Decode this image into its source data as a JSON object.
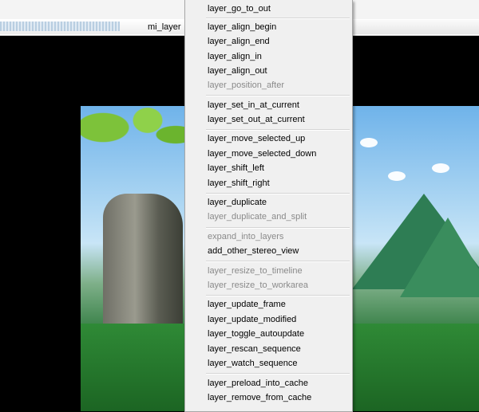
{
  "header": {
    "panel_label": "mi_layer"
  },
  "menu": {
    "items": [
      {
        "label": "layer_go_to_out",
        "enabled": true
      },
      {
        "label": "layer_align_begin",
        "enabled": true
      },
      {
        "label": "layer_align_end",
        "enabled": true
      },
      {
        "label": "layer_align_in",
        "enabled": true
      },
      {
        "label": "layer_align_out",
        "enabled": true
      },
      {
        "label": "layer_position_after",
        "enabled": false
      },
      {
        "label": "layer_set_in_at_current",
        "enabled": true
      },
      {
        "label": "layer_set_out_at_current",
        "enabled": true
      },
      {
        "label": "layer_move_selected_up",
        "enabled": true
      },
      {
        "label": "layer_move_selected_down",
        "enabled": true
      },
      {
        "label": "layer_shift_left",
        "enabled": true
      },
      {
        "label": "layer_shift_right",
        "enabled": true
      },
      {
        "label": "layer_duplicate",
        "enabled": true
      },
      {
        "label": "layer_duplicate_and_split",
        "enabled": false
      },
      {
        "label": "expand_into_layers",
        "enabled": false
      },
      {
        "label": "add_other_stereo_view",
        "enabled": true
      },
      {
        "label": "layer_resize_to_timeline",
        "enabled": false
      },
      {
        "label": "layer_resize_to_workarea",
        "enabled": false
      },
      {
        "label": "layer_update_frame",
        "enabled": true
      },
      {
        "label": "layer_update_modified",
        "enabled": true
      },
      {
        "label": "layer_toggle_autoupdate",
        "enabled": true
      },
      {
        "label": "layer_rescan_sequence",
        "enabled": true
      },
      {
        "label": "layer_watch_sequence",
        "enabled": true
      },
      {
        "label": "layer_preload_into_cache",
        "enabled": true
      },
      {
        "label": "layer_remove_from_cache",
        "enabled": true
      }
    ]
  }
}
